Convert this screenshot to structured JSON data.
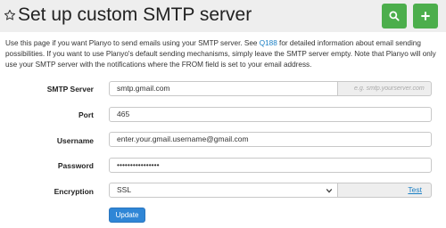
{
  "header": {
    "title": "Set up custom SMTP server",
    "icons": {
      "star": "star-icon",
      "search": "search-icon",
      "add": "plus-icon"
    },
    "button_color": "#4cae4c"
  },
  "intro": {
    "text_before": "Use this page if you want Planyo to send emails using your SMTP server. See ",
    "link": "Q188",
    "text_after": " for detailed information about email sending possibilities. If you want to use Planyo's default sending mechanisms, simply leave the SMTP server empty. Note that Planyo will only use your SMTP server with the notifications where the FROM field is set to your email address."
  },
  "form": {
    "smtp_server": {
      "label": "SMTP Server",
      "value": "smtp.gmail.com",
      "hint": "e.g. smtp.yourserver.com"
    },
    "port": {
      "label": "Port",
      "value": "465"
    },
    "username": {
      "label": "Username",
      "value": "enter.your.gmail.username@gmail.com"
    },
    "password": {
      "label": "Password",
      "value": "••••••••••••••••"
    },
    "encryption": {
      "label": "Encryption",
      "value": "SSL",
      "test_label": "Test"
    },
    "update_label": "Update"
  },
  "colors": {
    "link": "#1a7fc4",
    "primary_button": "#2f86d6"
  }
}
